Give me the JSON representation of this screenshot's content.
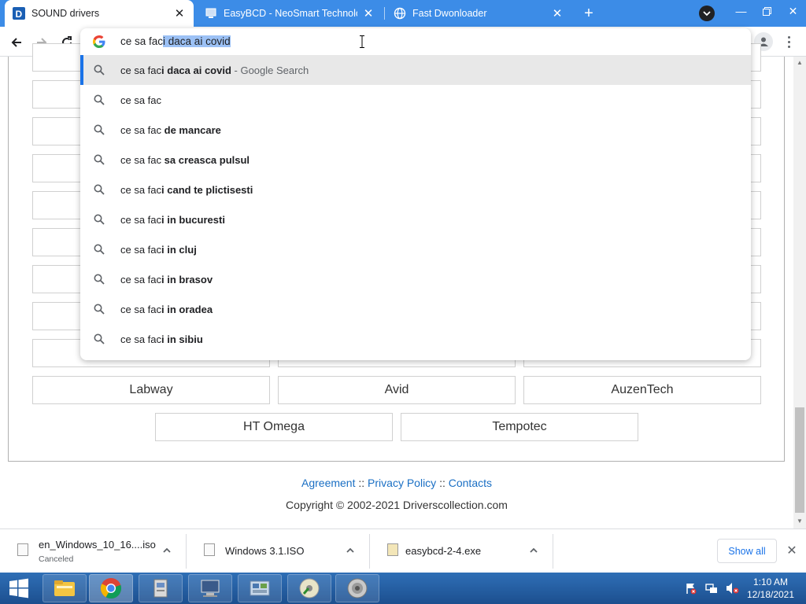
{
  "tabs": [
    {
      "title": "SOUND drivers",
      "active": true
    },
    {
      "title": "EasyBCD - NeoSmart Technologies",
      "active": false
    },
    {
      "title": "Fast Dwonloader",
      "active": false
    }
  ],
  "omnibox": {
    "typed": "ce sa fac",
    "selected": "i daca ai covid",
    "suggestions": [
      {
        "prefix": "ce sa fac",
        "bold": "i daca ai covid",
        "hint": " - Google Search",
        "highlighted": true
      },
      {
        "prefix": "ce sa fac",
        "bold": "",
        "hint": ""
      },
      {
        "prefix": "ce sa fac ",
        "bold": "de mancare",
        "hint": ""
      },
      {
        "prefix": "ce sa fac ",
        "bold": "sa creasca pulsul",
        "hint": ""
      },
      {
        "prefix": "ce sa fac",
        "bold": "i cand te plictisesti",
        "hint": ""
      },
      {
        "prefix": "ce sa fac",
        "bold": "i in bucuresti",
        "hint": ""
      },
      {
        "prefix": "ce sa fac",
        "bold": "i in cluj",
        "hint": ""
      },
      {
        "prefix": "ce sa fac",
        "bold": "i in brasov",
        "hint": ""
      },
      {
        "prefix": "ce sa fac",
        "bold": "i in oradea",
        "hint": ""
      },
      {
        "prefix": "ce sa fac",
        "bold": "i in sibiu",
        "hint": ""
      }
    ]
  },
  "brands": {
    "row1": [
      "Labway",
      "Avid",
      "AuzenTech"
    ],
    "row2": [
      "HT Omega",
      "Tempotec"
    ]
  },
  "footer": {
    "agreement": "Agreement",
    "privacy": "Privacy Policy",
    "contacts": "Contacts",
    "sep": "::",
    "copyright": "Copyright © 2002-2021 Driverscollection.com"
  },
  "downloads": [
    {
      "name": "en_Windows_10_16....iso",
      "status": "Canceled"
    },
    {
      "name": "Windows 3.1.ISO",
      "status": ""
    },
    {
      "name": "easybcd-2-4.exe",
      "status": ""
    }
  ],
  "downloadbar": {
    "show_all": "Show all"
  },
  "clock": {
    "time": "1:10 AM",
    "date": "12/18/2021"
  },
  "colors": {
    "accent": "#1a73e8",
    "tabstrip": "#3c8ce7"
  }
}
